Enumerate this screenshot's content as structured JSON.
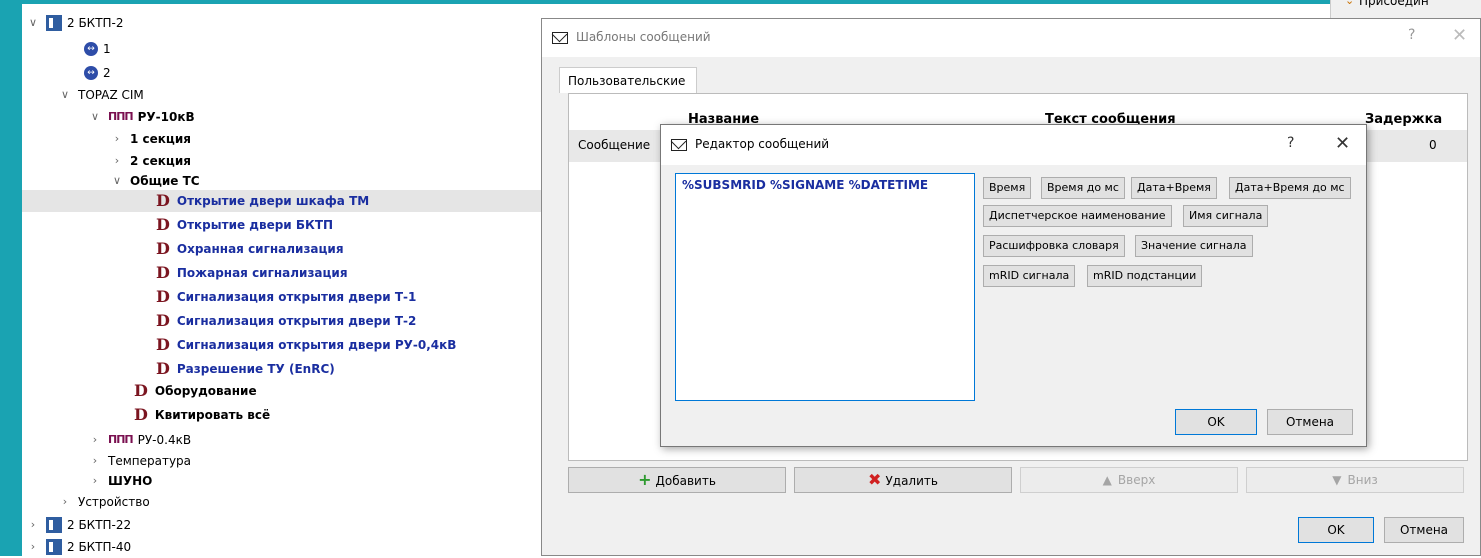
{
  "tree": {
    "items": [
      {
        "label": "2 БКТП-2",
        "arrow": "∨",
        "icon": "station-icon"
      },
      {
        "label": "1",
        "arrow": "",
        "icon": "connector-icon"
      },
      {
        "label": "2",
        "arrow": "",
        "icon": "connector-icon"
      },
      {
        "label": "TOPAZ CIM",
        "arrow": "∨",
        "icon": ""
      },
      {
        "label": "РУ-10кВ",
        "arrow": "∨",
        "icon": "switchgear-icon"
      },
      {
        "label": "1 секция",
        "arrow": "›",
        "icon": ""
      },
      {
        "label": "2 секция",
        "arrow": "›",
        "icon": ""
      },
      {
        "label": "Общие ТС",
        "arrow": "∨",
        "icon": ""
      },
      {
        "label": "Открытие двери шкафа ТМ",
        "arrow": "",
        "icon": "d-signal-icon"
      },
      {
        "label": "Открытие двери БКТП",
        "arrow": "",
        "icon": "d-signal-icon"
      },
      {
        "label": "Охранная сигнализация",
        "arrow": "",
        "icon": "d-signal-icon"
      },
      {
        "label": "Пожарная сигнализация",
        "arrow": "",
        "icon": "d-signal-icon"
      },
      {
        "label": "Сигнализация открытия двери Т-1",
        "arrow": "",
        "icon": "d-signal-icon"
      },
      {
        "label": "Сигнализация открытия двери Т-2",
        "arrow": "",
        "icon": "d-signal-icon"
      },
      {
        "label": "Сигнализация открытия двери РУ-0,4кВ",
        "arrow": "",
        "icon": "d-signal-icon"
      },
      {
        "label": "Разрешение ТУ (EnRC)",
        "arrow": "",
        "icon": "d-signal-icon"
      },
      {
        "label": "Оборудование",
        "arrow": "",
        "icon": "d-signal-icon"
      },
      {
        "label": "Квитировать всё",
        "arrow": "",
        "icon": "d-signal-icon"
      },
      {
        "label": "РУ-0.4кВ",
        "arrow": "›",
        "icon": "switchgear-icon"
      },
      {
        "label": "Температура",
        "arrow": "›",
        "icon": ""
      },
      {
        "label": "ШУНО",
        "arrow": "›",
        "icon": ""
      },
      {
        "label": "Устройство",
        "arrow": "›",
        "icon": ""
      },
      {
        "label": "2 БКТП-22",
        "arrow": "›",
        "icon": "station-icon"
      },
      {
        "label": "2 БКТП-40",
        "arrow": "›",
        "icon": "station-icon"
      }
    ],
    "d_glyph": "D",
    "ru_glyph": "ΠΠΠ"
  },
  "templates_dialog": {
    "title": "Шаблоны сообщений",
    "help": "?",
    "close": "✕",
    "tab": "Пользовательские",
    "columns": {
      "name": "Название",
      "text": "Текст сообщения",
      "delay": "Задержка"
    },
    "row": {
      "name": "Сообщение",
      "delay": "0"
    },
    "buttons": {
      "add": "Добавить",
      "delete": "Удалить",
      "up": "Вверх",
      "down": "Вниз",
      "ok": "OK",
      "cancel": "Отмена"
    }
  },
  "editor_dialog": {
    "title": "Редактор сообщений",
    "help": "?",
    "close": "✕",
    "text": "%SUBSMRID %SIGNAME %DATETIME",
    "tags": [
      "Время",
      "Время до мс",
      "Дата+Время",
      "Дата+Время до мс",
      "Диспетчерское наименование",
      "Имя сигнала",
      "Расшифровка словаря",
      "Значение сигнала",
      "mRID сигнала",
      "mRID подстанции"
    ],
    "ok": "OK",
    "cancel": "Отмена"
  },
  "top_right_partial": "Присоедин"
}
